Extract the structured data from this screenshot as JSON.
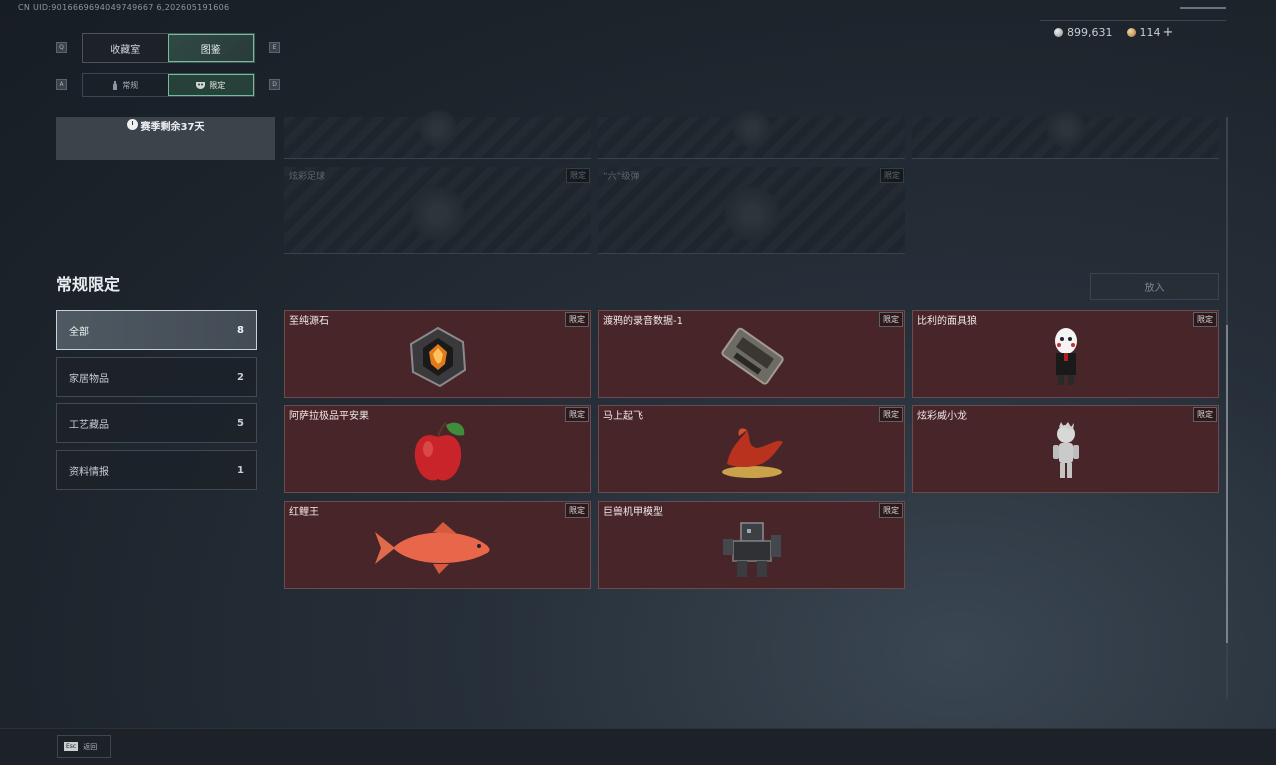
{
  "uid": "CN UID:9016669694049749667 6,202605191606",
  "currency": {
    "silver": "899,631",
    "bronze": "114"
  },
  "hotkeys": {
    "q": "Q",
    "e": "E",
    "a": "A",
    "d": "D"
  },
  "tabs": {
    "collection": "收藏室",
    "catalog": "图鉴"
  },
  "subtabs": {
    "regular": "常规",
    "limited": "限定"
  },
  "season": {
    "remaining": "赛季剩余37天"
  },
  "top_slots": [
    {
      "name": "炫彩足球",
      "tag": "限定"
    },
    {
      "name": "“六”级弹",
      "tag": "限定"
    }
  ],
  "section": {
    "title": "常规限定",
    "add_button": "放入"
  },
  "categories": [
    {
      "label": "全部",
      "count": "8"
    },
    {
      "label": "家居物品",
      "count": "2"
    },
    {
      "label": "工艺藏品",
      "count": "5"
    },
    {
      "label": "资料情报",
      "count": "1"
    }
  ],
  "items": [
    {
      "name": "至纯源石",
      "tag": "限定",
      "icon": "crystal-icon"
    },
    {
      "name": "渡鸦的录音数据-1",
      "tag": "限定",
      "icon": "tape-icon"
    },
    {
      "name": "比利的面具狼",
      "tag": "限定",
      "icon": "puppet-icon"
    },
    {
      "name": "阿萨拉极品平安果",
      "tag": "限定",
      "icon": "apple-icon"
    },
    {
      "name": "马上起飞",
      "tag": "限定",
      "icon": "horse-icon"
    },
    {
      "name": "炫彩威小龙",
      "tag": "限定",
      "icon": "figure-icon"
    },
    {
      "name": "红鲤王",
      "tag": "限定",
      "icon": "fish-icon"
    },
    {
      "name": "巨兽机甲模型",
      "tag": "限定",
      "icon": "mech-icon"
    }
  ],
  "footer": {
    "esc_key": "Esc",
    "back_label": "返回"
  }
}
